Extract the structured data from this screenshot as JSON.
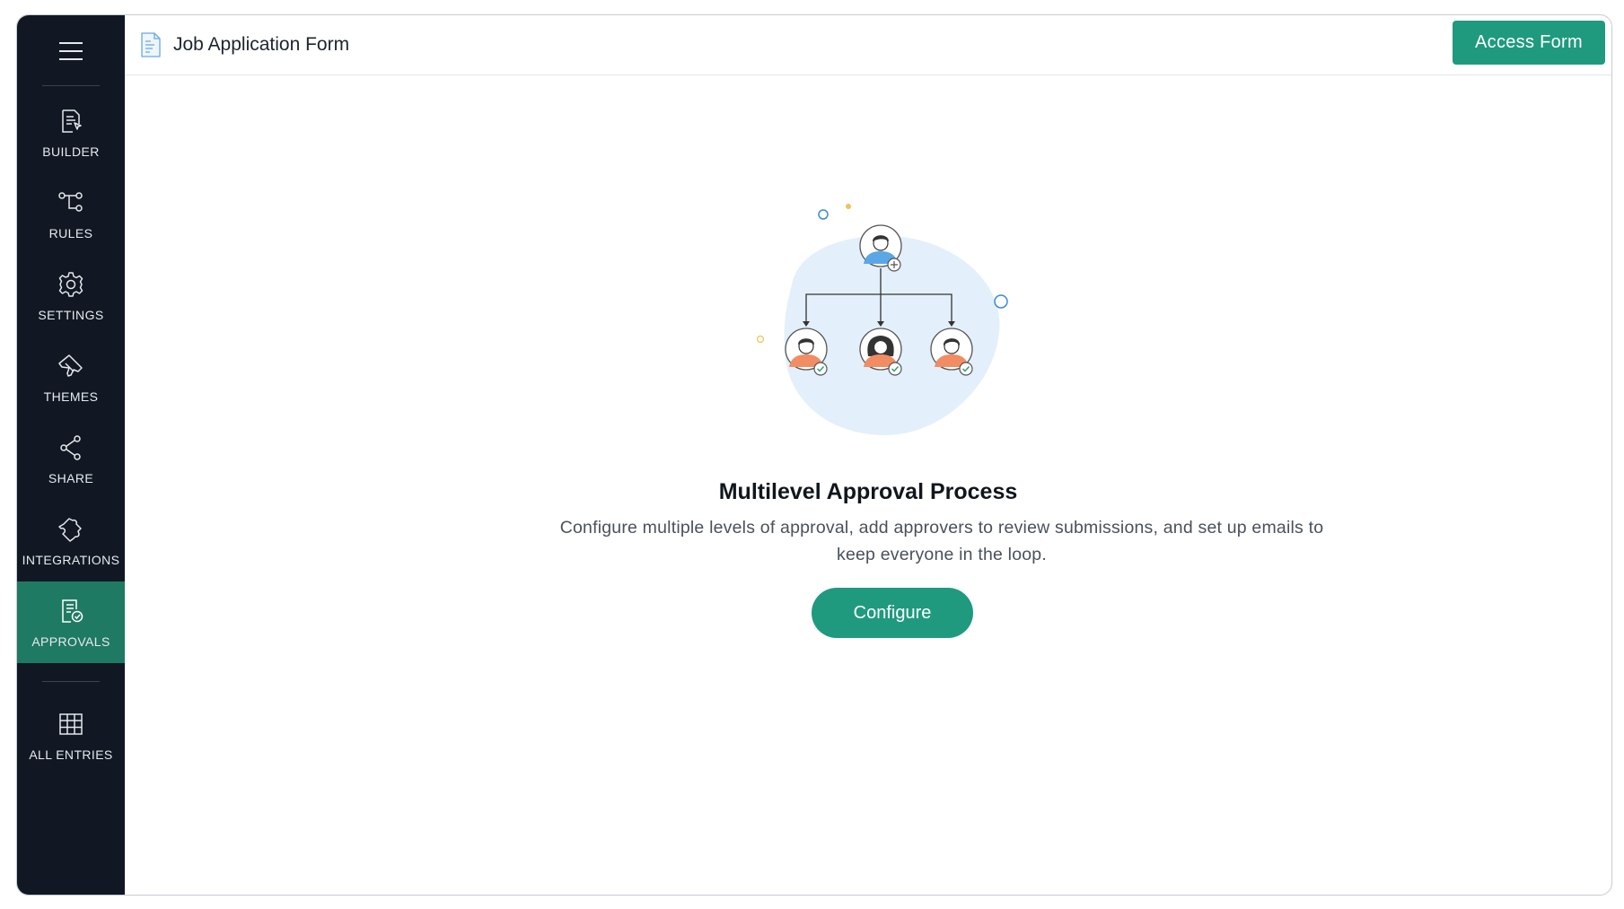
{
  "header": {
    "form_title": "Job Application Form",
    "access_button": "Access Form"
  },
  "sidebar": {
    "items": [
      {
        "label": "BUILDER",
        "icon": "builder-icon"
      },
      {
        "label": "RULES",
        "icon": "rules-icon"
      },
      {
        "label": "SETTINGS",
        "icon": "gear-icon"
      },
      {
        "label": "THEMES",
        "icon": "paint-brush-icon"
      },
      {
        "label": "SHARE",
        "icon": "share-icon"
      },
      {
        "label": "INTEGRATIONS",
        "icon": "puzzle-icon"
      },
      {
        "label": "APPROVALS",
        "icon": "approval-icon",
        "active": true
      },
      {
        "label": "ALL ENTRIES",
        "icon": "table-grid-icon"
      }
    ]
  },
  "main": {
    "heading": "Multilevel Approval Process",
    "description": "Configure multiple levels of approval, add approvers to review submissions, and set up emails to keep everyone in the loop.",
    "configure_button": "Configure"
  },
  "colors": {
    "sidebar_bg": "#111823",
    "active_bg": "#1f7a63",
    "accent": "#1f9a7e"
  }
}
